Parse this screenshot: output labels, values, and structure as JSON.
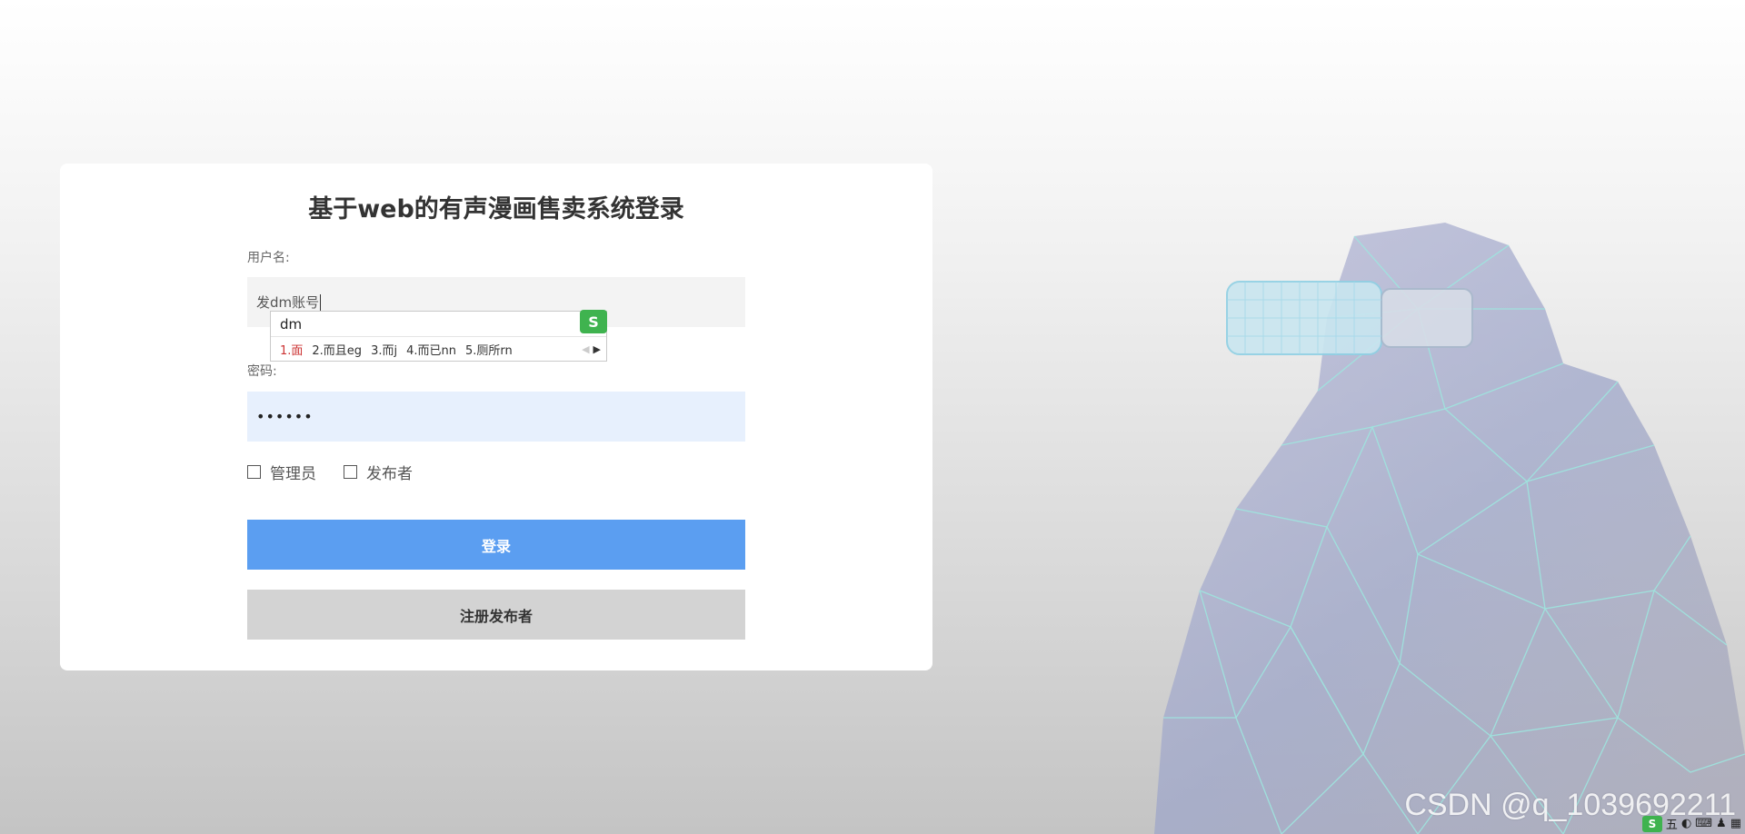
{
  "login": {
    "title": "基于web的有声漫画售卖系统登录",
    "username_label": "用户名:",
    "username_value": "发dm账号",
    "password_label": "密码:",
    "password_value": "••••••",
    "roles": [
      {
        "label": "管理员"
      },
      {
        "label": "发布者"
      }
    ],
    "login_button": "登录",
    "register_button": "注册发布者"
  },
  "ime": {
    "composition": "dm",
    "candidates": [
      "1.面",
      "2.而且eg",
      "3.而j",
      "4.而已nn",
      "5.厕所rn"
    ],
    "logo": "S"
  },
  "footer": {
    "watermark": "CSDN @q_1039692211",
    "tray_logo": "S",
    "tray_text": "五"
  },
  "colors": {
    "accent": "#5b9ef1",
    "secondary_button": "#d3d3d3",
    "password_field_bg": "#e7f0fd"
  }
}
